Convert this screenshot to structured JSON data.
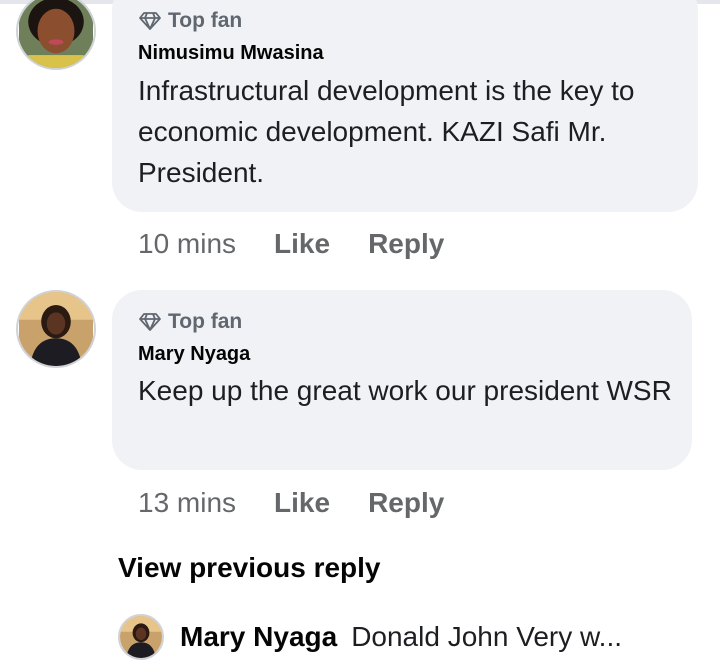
{
  "comments": [
    {
      "badge": "Top fan",
      "author": "Nimusimu Mwasina",
      "text": "Infrastructural development is the key to economic development. KAZI Safi Mr. President.",
      "time": "10 mins",
      "like": "Like",
      "reply": "Reply"
    },
    {
      "badge": "Top fan",
      "author": "Mary Nyaga",
      "text": "Keep up the great work  our president WSR",
      "time": "13 mins",
      "like": "Like",
      "reply": "Reply"
    }
  ],
  "view_previous": "View previous reply",
  "reply_preview": {
    "author": "Mary Nyaga",
    "text": "Donald John  Very w..."
  },
  "icons": {
    "badge": "diamond-icon"
  }
}
